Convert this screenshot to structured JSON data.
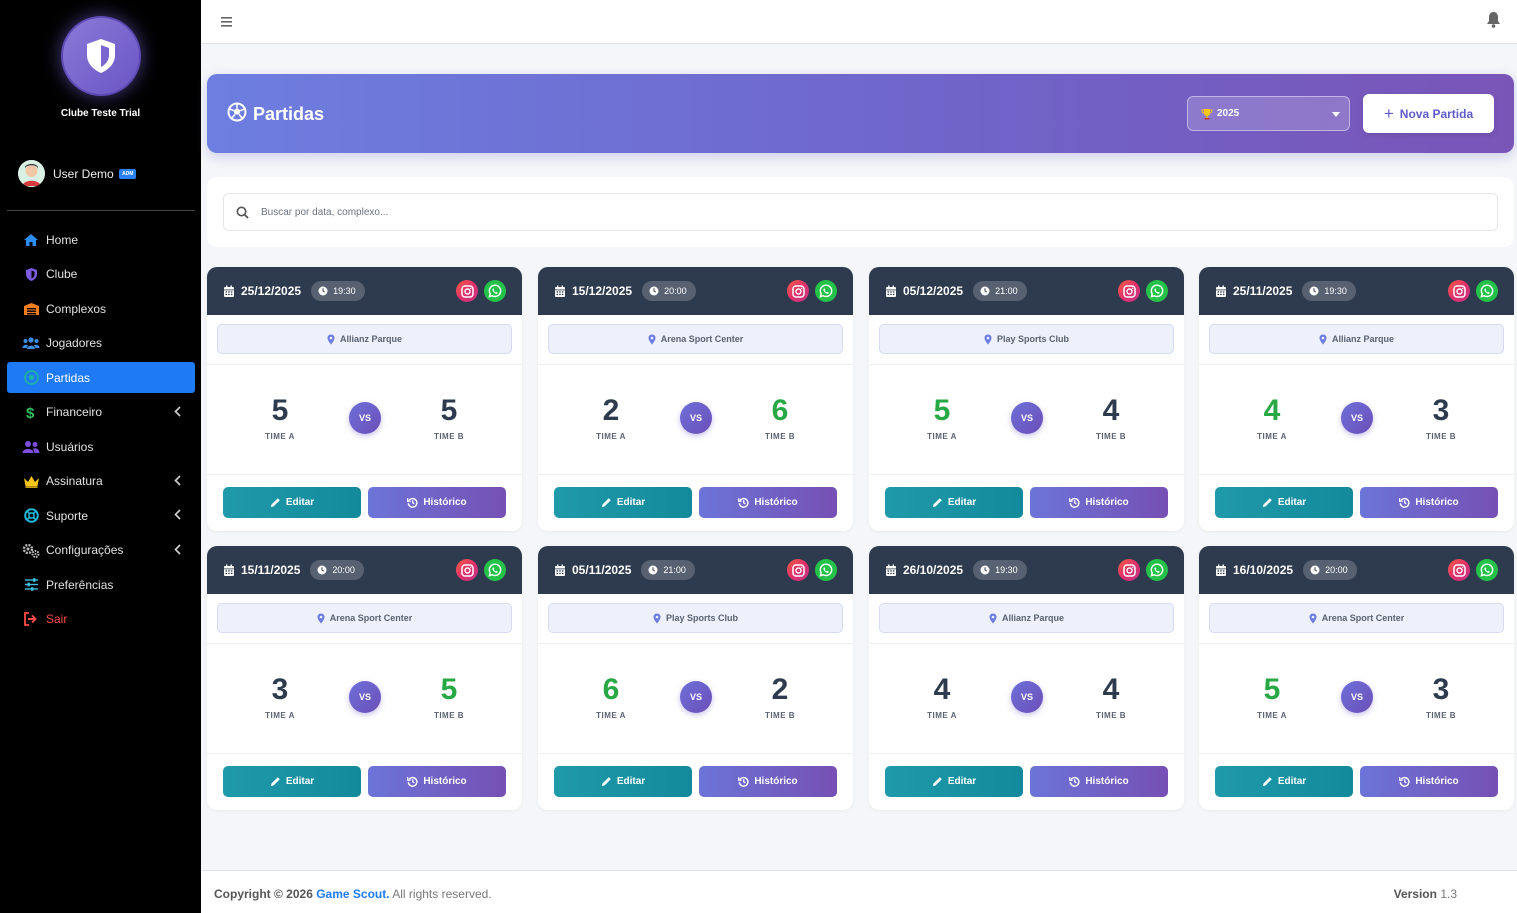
{
  "brand": {
    "name": "Clube Teste Trial"
  },
  "user": {
    "name": "User Demo",
    "badge": "ADM"
  },
  "nav": [
    {
      "label": "Home",
      "icon": "home-icon",
      "color": "#2d8cf0",
      "chevron": false,
      "active": false
    },
    {
      "label": "Clube",
      "icon": "shield-icon",
      "color": "#7b5ce0",
      "chevron": false,
      "active": false
    },
    {
      "label": "Complexos",
      "icon": "warehouse-icon",
      "color": "#f07d1e",
      "chevron": false,
      "active": false
    },
    {
      "label": "Jogadores",
      "icon": "users-icon",
      "color": "#3a8ee6",
      "chevron": false,
      "active": false
    },
    {
      "label": "Partidas",
      "icon": "soccer-ball-icon",
      "color": "#1fb89a",
      "chevron": false,
      "active": true
    },
    {
      "label": "Financeiro",
      "icon": "dollar-icon",
      "color": "#2fbf5c",
      "chevron": true,
      "active": false
    },
    {
      "label": "Usuários",
      "icon": "user-group-icon",
      "color": "#7c4ddb",
      "chevron": false,
      "active": false
    },
    {
      "label": "Assinatura",
      "icon": "crown-icon",
      "color": "#f5c518",
      "chevron": true,
      "active": false
    },
    {
      "label": "Suporte",
      "icon": "lifebuoy-icon",
      "color": "#1fb8d8",
      "chevron": true,
      "active": false
    },
    {
      "label": "Configurações",
      "icon": "gears-icon",
      "color": "#bbbbbb",
      "chevron": true,
      "active": false
    },
    {
      "label": "Preferências",
      "icon": "sliders-icon",
      "color": "#3fc0e0",
      "chevron": false,
      "active": false
    },
    {
      "label": "Sair",
      "icon": "sign-out-icon",
      "color": "#ff4a4a",
      "chevron": false,
      "active": false,
      "danger": true
    }
  ],
  "header": {
    "title": "Partidas",
    "year": "2025",
    "new_button": "Nova Partida"
  },
  "search": {
    "placeholder": "Buscar por data, complexo..."
  },
  "team_labels": {
    "a": "TIME A",
    "b": "TIME B"
  },
  "vs_label": "VS",
  "buttons": {
    "edit": "Editar",
    "history": "Histórico"
  },
  "matches": [
    {
      "date": "25/12/2025",
      "time": "19:30",
      "venue": "Allianz Parque",
      "score_a": "5",
      "score_b": "5"
    },
    {
      "date": "15/12/2025",
      "time": "20:00",
      "venue": "Arena Sport Center",
      "score_a": "2",
      "score_b": "6"
    },
    {
      "date": "05/12/2025",
      "time": "21:00",
      "venue": "Play Sports Club",
      "score_a": "5",
      "score_b": "4"
    },
    {
      "date": "25/11/2025",
      "time": "19:30",
      "venue": "Allianz Parque",
      "score_a": "4",
      "score_b": "3"
    },
    {
      "date": "15/11/2025",
      "time": "20:00",
      "venue": "Arena Sport Center",
      "score_a": "3",
      "score_b": "5"
    },
    {
      "date": "05/11/2025",
      "time": "21:00",
      "venue": "Play Sports Club",
      "score_a": "6",
      "score_b": "2"
    },
    {
      "date": "26/10/2025",
      "time": "19:30",
      "venue": "Allianz Parque",
      "score_a": "4",
      "score_b": "4"
    },
    {
      "date": "16/10/2025",
      "time": "20:00",
      "venue": "Arena Sport Center",
      "score_a": "5",
      "score_b": "3"
    }
  ],
  "footer": {
    "copyright": "Copyright © 2026",
    "brand": "Game Scout.",
    "rights": "All rights reserved.",
    "version_label": "Version",
    "version": "1.3"
  },
  "colors": {
    "accent": "#1e7bf5",
    "win": "#27a844",
    "card_header": "#2e3a4e"
  }
}
